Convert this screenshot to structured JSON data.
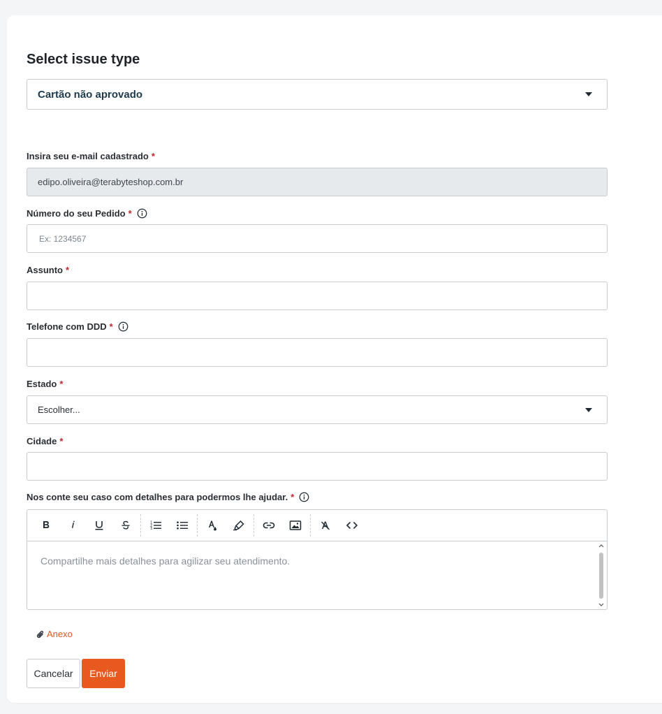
{
  "form": {
    "title": "Select issue type",
    "issue_type_value": "Cartão não aprovado",
    "email": {
      "label": "Insira seu e-mail cadastrado",
      "value": "edipo.oliveira@terabyteshop.com.br"
    },
    "order": {
      "label": "Número do seu Pedido",
      "placeholder": "Ex: 1234567"
    },
    "subject": {
      "label": "Assunto",
      "value": ""
    },
    "phone": {
      "label": "Telefone com DDD",
      "value": ""
    },
    "state": {
      "label": "Estado",
      "value": "Escolher..."
    },
    "city": {
      "label": "Cidade",
      "value": ""
    },
    "details": {
      "label": "Nos conte seu caso com detalhes para podermos lhe ajudar.",
      "placeholder": "Compartilhe mais detalhes para agilizar seu atendimento."
    },
    "required_mark": "*",
    "attachment_label": "Anexo",
    "cancel_label": "Cancelar",
    "submit_label": "Enviar"
  },
  "toolbar": {
    "groups": [
      [
        "bold-icon",
        "italic-icon",
        "underline-icon",
        "strikethrough-icon"
      ],
      [
        "ordered-list-icon",
        "bullet-list-icon"
      ],
      [
        "text-color-icon",
        "highlight-icon"
      ],
      [
        "link-icon",
        "image-icon"
      ],
      [
        "clear-format-icon",
        "code-icon"
      ]
    ]
  },
  "colors": {
    "accent": "#e8591f",
    "required": "#c0262d",
    "disabled_bg": "#e7eaed"
  }
}
